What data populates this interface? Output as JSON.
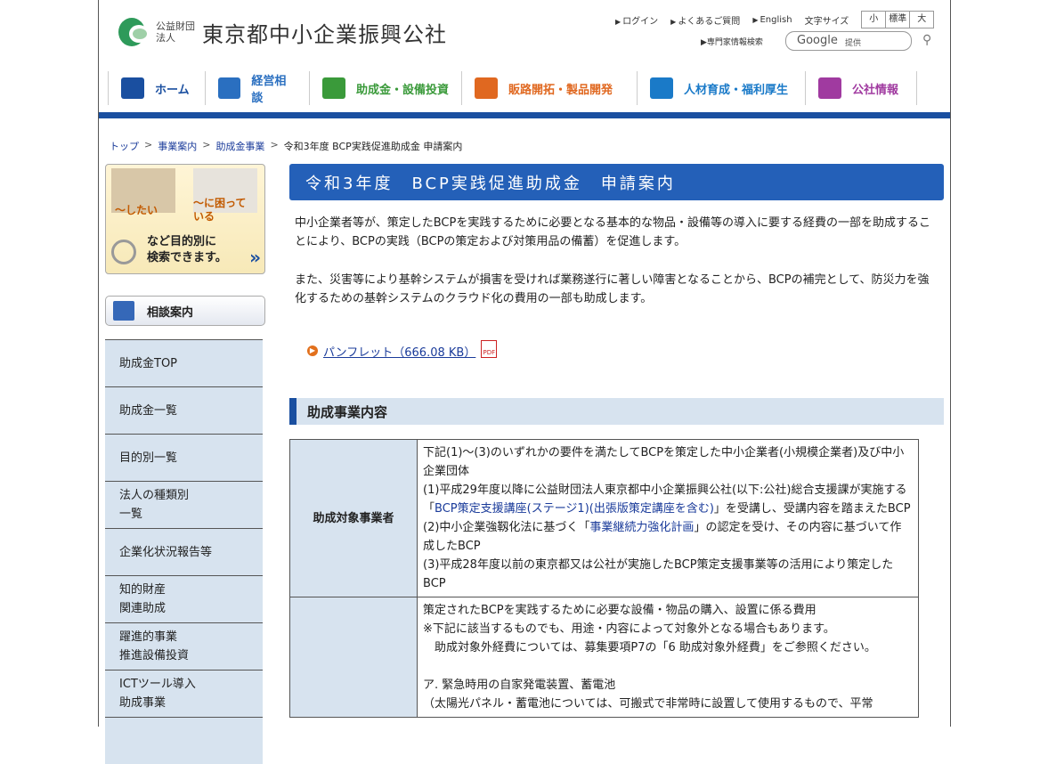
{
  "header": {
    "org_small": "公益財団法人",
    "org_name": "東京都中小企業振興公社",
    "links": [
      "ログイン",
      "よくあるご質問",
      "English"
    ],
    "font_size_label": "文字サイズ",
    "font_sizes": [
      "小",
      "標準",
      "大"
    ],
    "expert_search": "専門家情報検索",
    "search_brand": "Google",
    "search_suffix": "提供"
  },
  "gnav": [
    {
      "label": "ホーム",
      "color": "#1a4fa0"
    },
    {
      "label": "経営相談",
      "color": "#2a6fc0"
    },
    {
      "label": "助成金・設備投資",
      "color": "#3a9a3a"
    },
    {
      "label": "販路開拓・製品開発",
      "color": "#e06820"
    },
    {
      "label": "人材育成・福利厚生",
      "color": "#1a7ac8"
    },
    {
      "label": "公社情報",
      "color": "#a03aa0"
    }
  ],
  "breadcrumb": [
    "トップ",
    "事業案内",
    "助成金事業",
    "令和3年度 BCP実践促進助成金 申請案内"
  ],
  "sidebar": {
    "banner": {
      "left": "～したい",
      "right": "～に困って\nいる",
      "bottom": "など目的別に\n検索できます。"
    },
    "consult_label": "相談案内",
    "items": [
      "助成金TOP",
      "助成金一覧",
      "目的別一覧",
      "法人の種類別\n一覧",
      "企業化状況報告等",
      "知的財産\n関連助成",
      "躍進的事業\n推進設備投資",
      "ICTツール導入\n助成事業",
      ""
    ]
  },
  "main": {
    "title": "令和3年度　BCP実践促進助成金　申請案内",
    "para1": "中小企業者等が、策定したBCPを実践するために必要となる基本的な物品・設備等の導入に要する経費の一部を助成することにより、BCPの実践（BCPの策定および対策用品の備蓄）を促進します。",
    "para2": "また、災害等により基幹システムが損害を受ければ業務遂行に著しい障害となることから、BCPの補完として、防災力を強化するための基幹システムのクラウド化の費用の一部も助成します。",
    "pdf_link": "パンフレット（666.08 KB）",
    "section_title": "助成事業内容",
    "row1_head": "助成対象事業者",
    "row1": {
      "l1": "下記(1)～(3)のいずれかの要件を満たしてBCPを策定した中小企業者(小規模企業者)及び中小企業団体",
      "l2a": "(1)平成29年度以降に公益財団法人東京都中小企業振興公社(以下:公社)総合支援課が実施する「",
      "l2link": "BCP策定支援講座(ステージ1)(出張版策定講座を含む)",
      "l2b": "」を受講し、受講内容を踏まえたBCP",
      "l3a": "(2)中小企業強靱化法に基づく「",
      "l3link": "事業継続力強化計画",
      "l3b": "」の認定を受け、その内容に基づいて作成したBCP",
      "l4": "(3)平成28年度以前の東京都又は公社が実施したBCP策定支援事業等の活用により策定したBCP"
    },
    "row2": {
      "l1": "策定されたBCPを実践するために必要な設備・物品の購入、設置に係る費用",
      "l2": "※下記に該当するものでも、用途・内容によって対象外となる場合もあります。",
      "l3": "　助成対象外経費については、募集要項P7の「6 助成対象外経費」をご参照ください。",
      "l4": "ア. 緊急時用の自家発電装置、蓄電池",
      "l5": "（太陽光パネル・蓄電池については、可搬式で非常時に設置して使用するもので、平常"
    }
  }
}
